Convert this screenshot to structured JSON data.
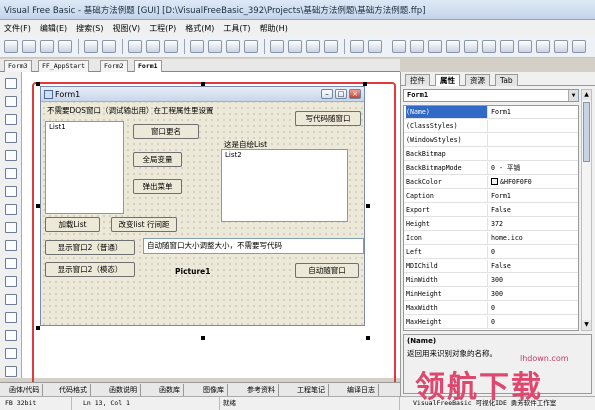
{
  "window": {
    "title": "Visual Free Basic - 基础方法例题 [GUI]  [D:\\VisualFreeBasic_392\\Projects\\基础方法例题\\基础方法例题.ffp]"
  },
  "menu": [
    "文件(F)",
    "编辑(E)",
    "搜索(S)",
    "视图(V)",
    "工程(P)",
    "格式(M)",
    "工具(T)",
    "帮助(H)"
  ],
  "doc_tabs": [
    "Form3",
    "FF_AppStart",
    "Form2",
    "Form1"
  ],
  "active_doc_tab": "Form1",
  "form": {
    "title": "Form1",
    "note_label": "不需要DOS窗口（调试输出用）在工程属性里设置",
    "btn_write_code_window": "写代码随窗口",
    "list1_label": "List1",
    "btn_window_resize": "窗口更名",
    "btn_global_var": "全局变量",
    "btn_popup_menu": "弹出菜单",
    "list2_caption": "这是自绘List",
    "list2_label": "List2",
    "btn_load_list": "加载List",
    "btn_change_list_height": "改变list 行间距",
    "btn_show_form2_normal": "显示窗口2（普通）",
    "btn_show_form2_modal": "显示窗口2（模态）",
    "text_auto_resize": "自动随窗口大小调整大小，不需要写代码",
    "picture_label": "Picture1",
    "btn_auto_follow": "自动随窗口"
  },
  "bottom_tabs": [
    "函体/代码",
    "代码格式",
    "函数说明",
    "函数库",
    "图像库",
    "参考资料",
    "工程笔记",
    "编译日志"
  ],
  "status": {
    "mode": "FB 32bit",
    "position": "Ln 13,  Col 1",
    "state": "就绪",
    "brand": "VisualFreeBasic 可视化IDE 勇芳软件工作室"
  },
  "panel": {
    "tabs": [
      "控件",
      "属性",
      "资源",
      "Tab"
    ],
    "active_tab": "属性",
    "object": "Form1",
    "properties": [
      {
        "name": "(Name)",
        "value": "Form1"
      },
      {
        "name": "(ClassStyles)",
        "value": ""
      },
      {
        "name": "(WindowStyles)",
        "value": ""
      },
      {
        "name": "BackBitmap",
        "value": ""
      },
      {
        "name": "BackBitmapMode",
        "value": "0 - 平铺"
      },
      {
        "name": "BackColor",
        "value": "&HF0F0F0"
      },
      {
        "name": "Caption",
        "value": "Form1"
      },
      {
        "name": "Export",
        "value": "False"
      },
      {
        "name": "Height",
        "value": "372"
      },
      {
        "name": "Icon",
        "value": "home.ico"
      },
      {
        "name": "Left",
        "value": "0"
      },
      {
        "name": "MDIChild",
        "value": "False"
      },
      {
        "name": "MinWidth",
        "value": "300"
      },
      {
        "name": "MinHeight",
        "value": "300"
      },
      {
        "name": "MaxWidth",
        "value": "0"
      },
      {
        "name": "MaxHeight",
        "value": "0"
      }
    ],
    "desc_title": "(Name)",
    "desc_text": "返回用来识别对象的名称。"
  },
  "watermark": {
    "domain": "lhdown.com",
    "text": "领航下载"
  },
  "colors": {
    "highlight": "#e0393e",
    "selection": "#3169c6",
    "watermark": "#e0476e"
  }
}
